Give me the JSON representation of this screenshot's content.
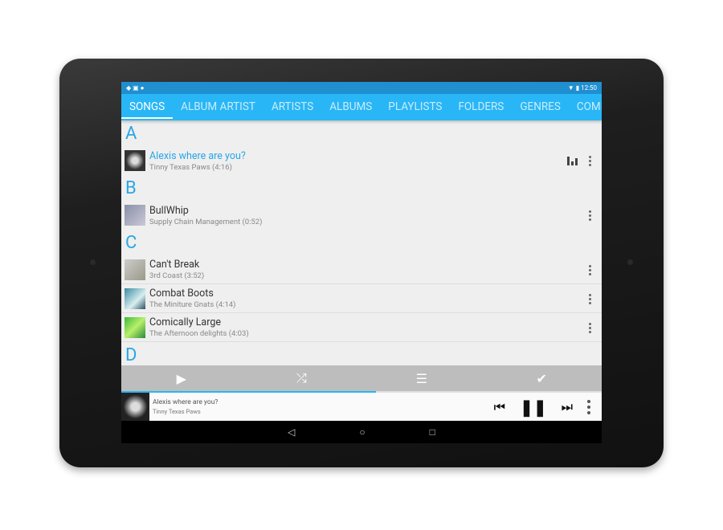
{
  "status": {
    "time": "12:50"
  },
  "tabs": [
    {
      "label": "SONGS",
      "active": true
    },
    {
      "label": "ALBUM ARTIST"
    },
    {
      "label": "ARTISTS"
    },
    {
      "label": "ALBUMS"
    },
    {
      "label": "PLAYLISTS"
    },
    {
      "label": "FOLDERS"
    },
    {
      "label": "GENRES"
    },
    {
      "label": "COMPOSERS"
    }
  ],
  "sections": {
    "a": "A",
    "b": "B",
    "c": "C",
    "d": "D"
  },
  "songs": [
    {
      "title": "Alexis where are you?",
      "subtitle": "Tinny Texas Paws (4:16)",
      "playing": true
    },
    {
      "title": "BullWhip",
      "subtitle": "Supply Chain Management (0:52)"
    },
    {
      "title": "Can't Break",
      "subtitle": "3rd Coast (3:52)"
    },
    {
      "title": "Combat Boots",
      "subtitle": "The Miniture Gnats (4:14)"
    },
    {
      "title": "Comically Large",
      "subtitle": "The Afternoon delights (4:03)"
    }
  ],
  "now_playing": {
    "title": "Alexis where are you?",
    "artist": "Tinny Texas Paws",
    "progress_percent": 53
  },
  "colors": {
    "accent": "#29b6f6",
    "statusbar": "#1f8fd0",
    "action_bar": "#bdbdbd"
  }
}
